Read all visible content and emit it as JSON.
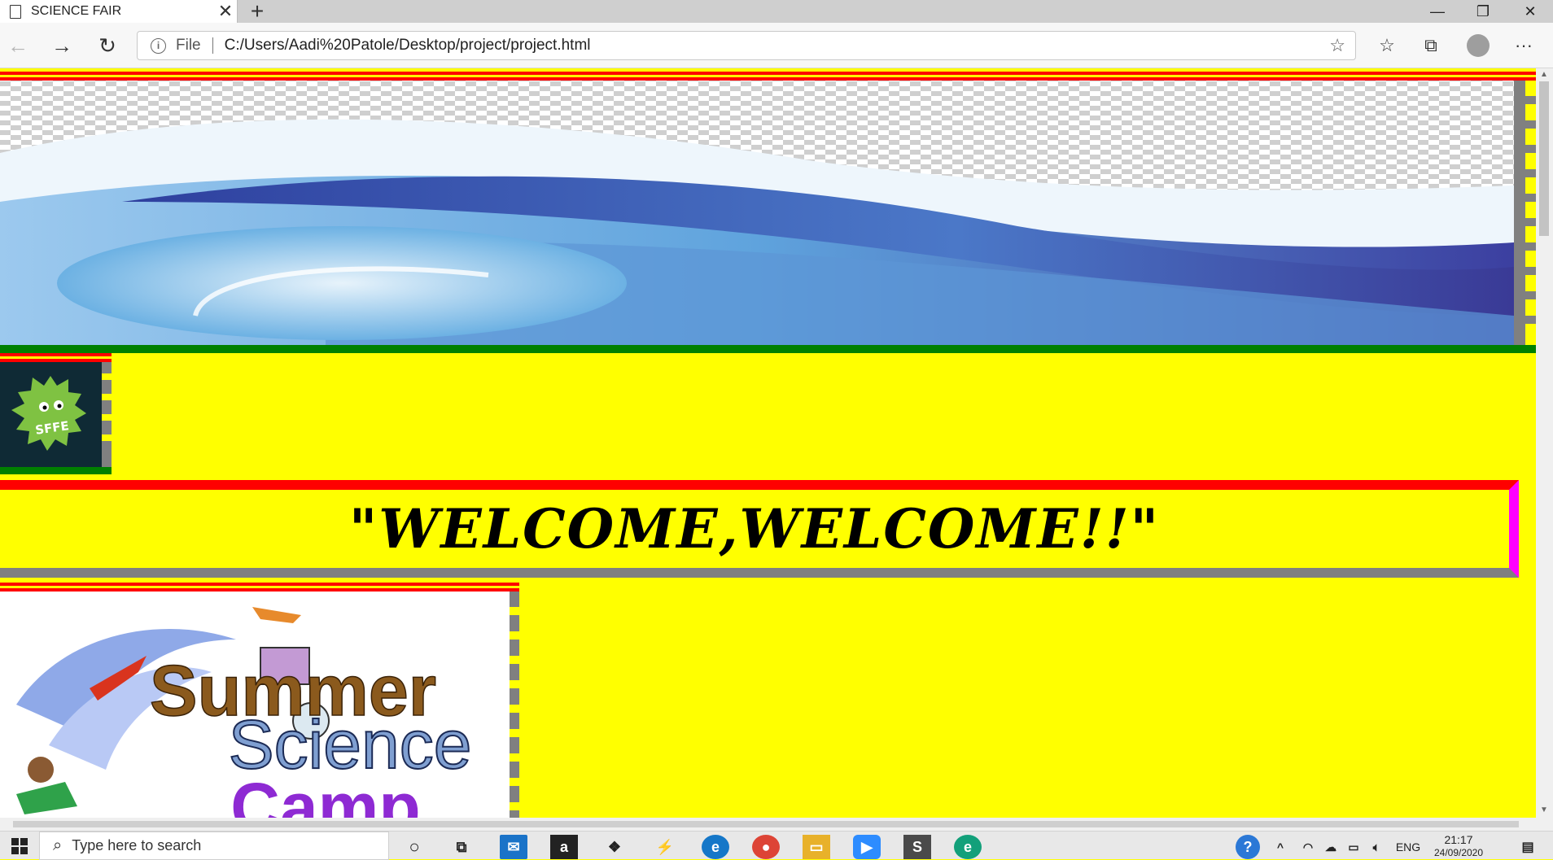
{
  "browser": {
    "tab_title": "SCIENCE FAIR",
    "address_scheme": "File",
    "url": "C:/Users/Aadi%20Patole/Desktop/project/project.html"
  },
  "page": {
    "logo_text": "SFFE",
    "welcome_text": "\"WELCOME,WELCOME!!\"",
    "camp_image_text": [
      "Summer",
      "Science",
      "Camp"
    ],
    "colors": {
      "background": "#ffff00",
      "border_top": "#ff0000",
      "border_right": "#ff00ff",
      "border_bottom": "#808080",
      "banner_bottom": "#008000"
    }
  },
  "taskbar": {
    "search_placeholder": "Type here to search",
    "apps": [
      "cortana-icon",
      "task-view-icon",
      "mail-icon",
      "amazon-icon",
      "dropbox-icon",
      "app-icon",
      "edge-icon",
      "chrome-icon",
      "file-explorer-icon",
      "zoom-icon",
      "sublime-text-icon",
      "edge-beta-icon"
    ],
    "language": "ENG",
    "time": "21:17",
    "date": "24/09/2020"
  }
}
